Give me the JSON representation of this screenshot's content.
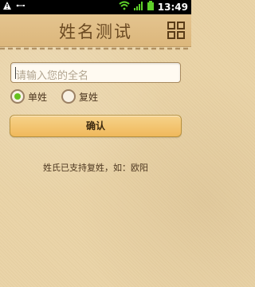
{
  "status_bar": {
    "time": "13:49"
  },
  "header": {
    "title": "姓名测试"
  },
  "form": {
    "name_input_placeholder": "请输入您的全名",
    "radio_single": {
      "label": "单姓",
      "selected": true
    },
    "radio_compound": {
      "label": "复姓",
      "selected": false
    },
    "confirm_label": "确认",
    "hint": "姓氏已支持复姓，如：欧阳"
  },
  "colors": {
    "accent": "#66c11f",
    "button_bg": "#f0b95c",
    "title_color": "#6b4a22"
  }
}
